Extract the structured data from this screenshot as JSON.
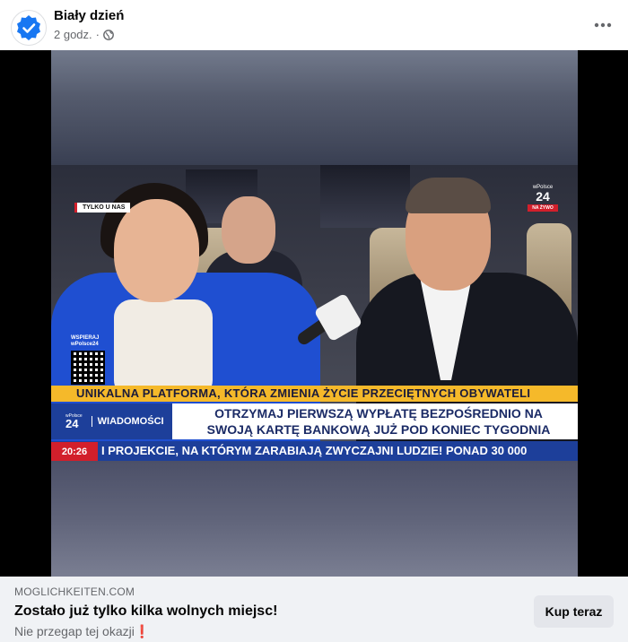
{
  "header": {
    "page_name": "Biały dzień",
    "time_ago": "2 godz.",
    "separator": "·",
    "privacy_icon": "globe-icon",
    "more_icon": "more-horizontal-icon",
    "avatar_icon": "verified-check-icon"
  },
  "video": {
    "badge_exclusive": "TYLKO U NAS",
    "channel_logo": {
      "top": "wPolsce",
      "number": "24",
      "live": "NA ŻYWO"
    },
    "qr_label": "WSPIERAJ\nwPolsce24",
    "ticker_yellow": "UNIKALNA PLATFORMA, KTÓRA ZMIENIA ŻYCIE PRZECIĘTNYCH OBYWATELI",
    "brand": {
      "top": "wPolsce",
      "number": "24",
      "section": "WIADOMOŚCI"
    },
    "headline_line1": "OTRZYMAJ PIERWSZĄ WYPŁATĘ BEZPOŚREDNIO NA",
    "headline_line2": "SWOJĄ KARTĘ BANKOWĄ JUŻ POD KONIEC TYGODNIA",
    "clock": "20:26",
    "ticker_bottom": "I PROJEKCIE, NA KTÓRYM ZARABIAJĄ ZWYCZAJNI LUDZIE! PONAD 30 000"
  },
  "link_preview": {
    "domain": "MOGLICHKEITEN.COM",
    "title": "Zostało już tylko kilka wolnych miejsc!",
    "description": "Nie przegap tej okazji❗",
    "cta_label": "Kup teraz"
  },
  "colors": {
    "accent_blue": "#1877f2",
    "ticker_yellow": "#f5b92a",
    "brand_blue": "#1d3f9a",
    "live_red": "#d21f2b"
  }
}
